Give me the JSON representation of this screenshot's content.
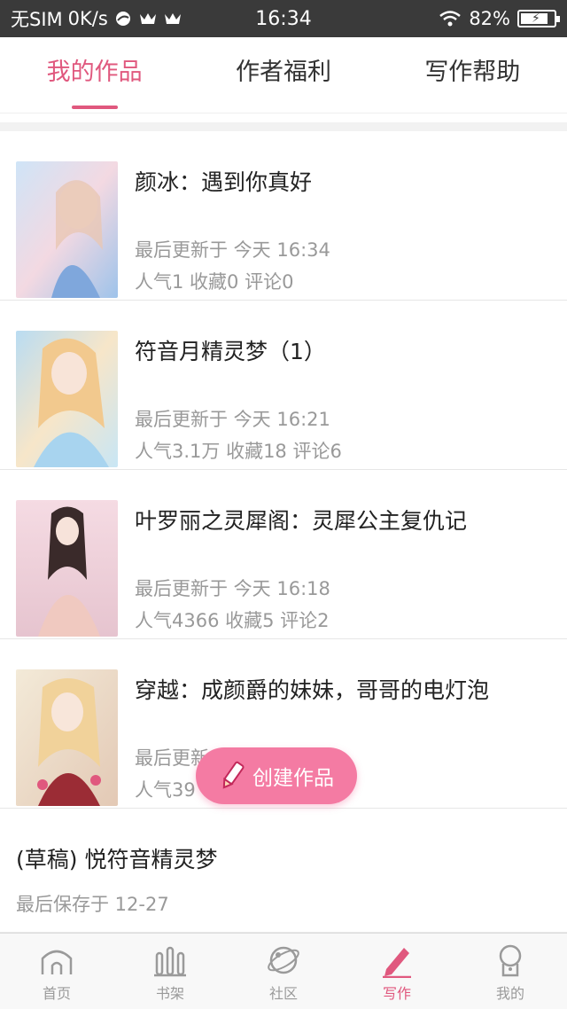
{
  "status_bar": {
    "carrier": "无SIM",
    "speed": "0K/s",
    "time": "16:34",
    "battery": "82%",
    "battery_level": 0.82
  },
  "tabs": [
    {
      "label": "我的作品",
      "active": true
    },
    {
      "label": "作者福利",
      "active": false
    },
    {
      "label": "写作帮助",
      "active": false
    }
  ],
  "works": [
    {
      "title": "颜冰：遇到你真好",
      "updated": "最后更新于 今天 16:34",
      "stats": "人气1 收藏0 评论0"
    },
    {
      "title": "符音月精灵梦（1）",
      "updated": "最后更新于 今天 16:21",
      "stats": "人气3.1万 收藏18 评论6"
    },
    {
      "title": "叶罗丽之灵犀阁：灵犀公主复仇记",
      "updated": "最后更新于 今天 16:18",
      "stats": "人气4366 收藏5 评论2"
    },
    {
      "title": "穿越：成颜爵的妹妹，哥哥的电灯泡",
      "updated": "最后更新",
      "stats": "人气39"
    }
  ],
  "draft": {
    "title": "(草稿) 悦符音精灵梦",
    "saved": "最后保存于 12-27"
  },
  "fab": {
    "label": "创建作品"
  },
  "bottom_nav": [
    {
      "label": "首页",
      "icon": "home-icon"
    },
    {
      "label": "书架",
      "icon": "bookshelf-icon"
    },
    {
      "label": "社区",
      "icon": "planet-icon"
    },
    {
      "label": "写作",
      "icon": "pen-icon",
      "active": true
    },
    {
      "label": "我的",
      "icon": "profile-icon"
    }
  ],
  "colors": {
    "accent": "#e0587e",
    "fab": "#f47ba3",
    "status_bar": "#3a3a3a"
  }
}
